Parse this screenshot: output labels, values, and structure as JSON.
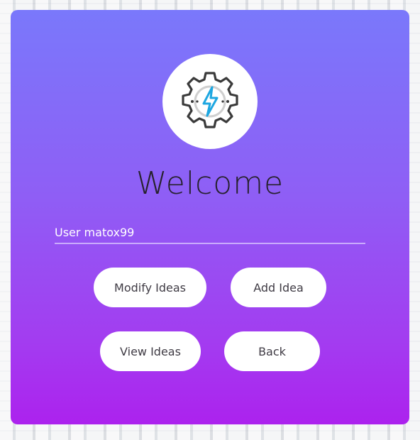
{
  "header": {
    "title": "Welcome",
    "logo_icon": "gear-lightning-icon"
  },
  "user": {
    "label": "User matox99"
  },
  "actions": {
    "modify_label": "Modify Ideas",
    "add_label": "Add Idea",
    "view_label": "View Ideas",
    "back_label": "Back"
  },
  "colors": {
    "gradient_top": "#7a78fb",
    "gradient_bottom": "#ac22ee",
    "title_text": "#26212c",
    "button_bg": "#ffffff",
    "button_text": "#3f3b44",
    "bolt": "#1ea7e1",
    "gear": "#3a3a3a"
  }
}
